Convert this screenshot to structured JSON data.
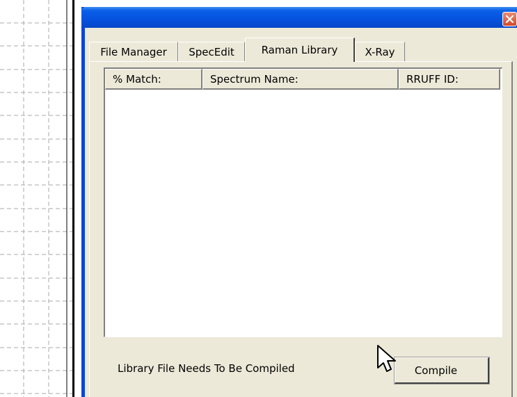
{
  "window": {
    "tabs": [
      {
        "label": "File Manager",
        "active": false
      },
      {
        "label": "SpecEdit",
        "active": false
      },
      {
        "label": "Raman Library",
        "active": true
      },
      {
        "label": "X-Ray",
        "active": false
      }
    ],
    "list": {
      "columns": [
        "% Match:",
        "Spectrum Name:",
        "RRUFF ID:"
      ],
      "rows": []
    },
    "status_text": "Library File Needs To Be Compiled",
    "compile_label": "Compile"
  },
  "colors": {
    "title_bar": "#0553e0",
    "window_bg": "#ece9d8",
    "close_button": "#d8472a",
    "grid_line": "#a8a8a8"
  },
  "icons": {
    "close": "close-icon",
    "cursor": "mouse-pointer-icon"
  }
}
